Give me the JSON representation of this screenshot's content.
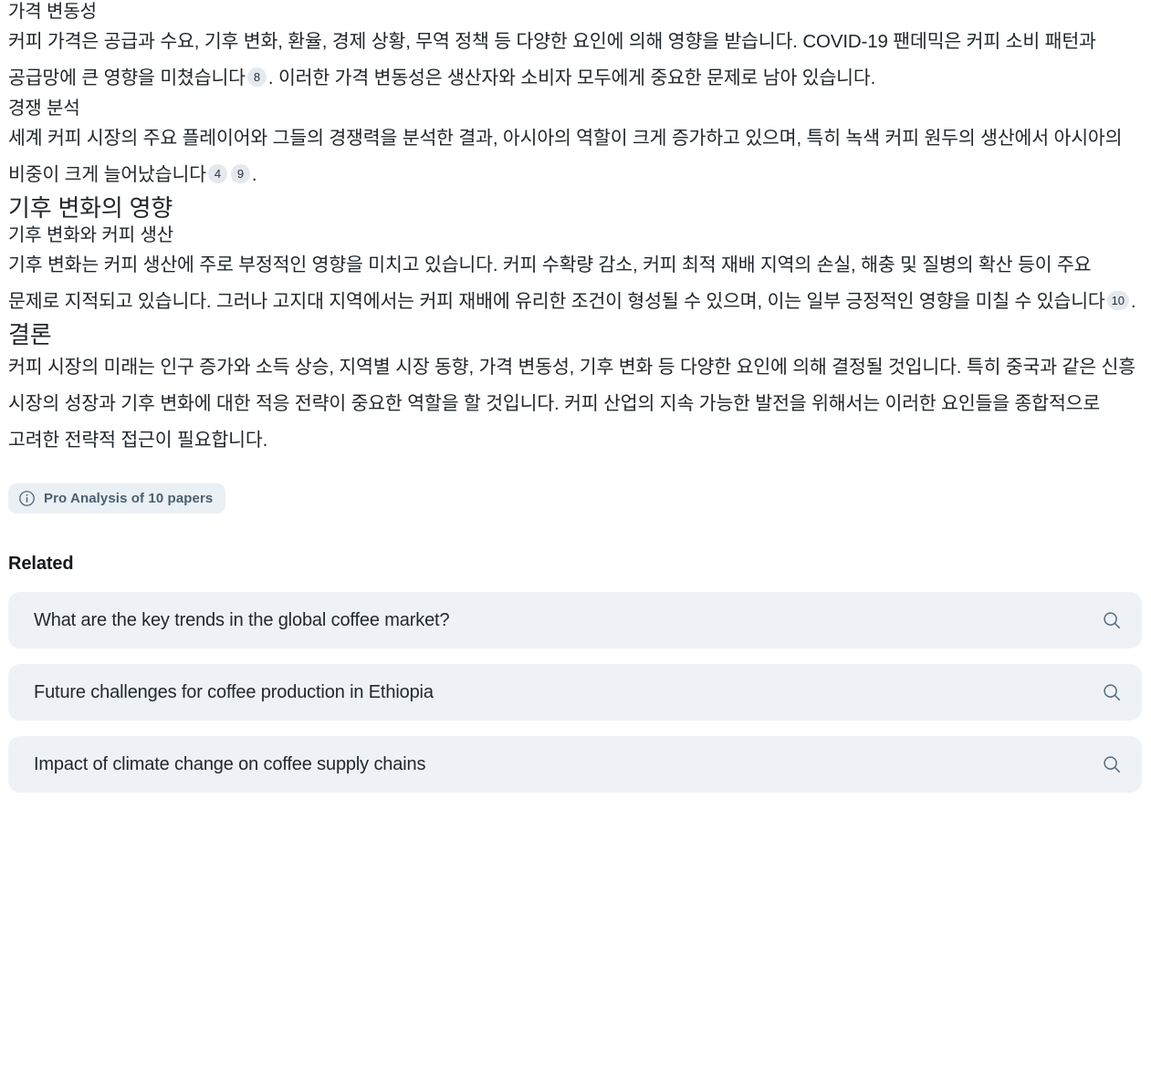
{
  "sections": {
    "price_volatility": {
      "heading": "가격 변동성",
      "paragraph_part1": "커피 가격은 공급과 수요, 기후 변화, 환율, 경제 상황, 무역 정책 등 다양한 요인에 의해 영향을 받습니다. COVID-19 팬데믹은 커피 소비 패턴과 공급망에 큰 영향을 미쳤습니다",
      "citation1": "8",
      "paragraph_part2": ". 이러한 가격 변동성은 생산자와 소비자 모두에게 중요한 문제로 남아 있습니다."
    },
    "competitive_analysis": {
      "heading": "경쟁 분석",
      "paragraph_part1": "세계 커피 시장의 주요 플레이어와 그들의 경쟁력을 분석한 결과, 아시아의 역할이 크게 증가하고 있으며, 특히 녹색 커피 원두의 생산에서 아시아의 비중이 크게 늘어났습니다",
      "citation1": "4",
      "citation2": "9",
      "paragraph_part2": "."
    },
    "climate_impact": {
      "heading": "기후 변화의 영향",
      "subheading": "기후 변화와 커피 생산",
      "paragraph_part1": "기후 변화는 커피 생산에 주로 부정적인 영향을 미치고 있습니다. 커피 수확량 감소, 커피 최적 재배 지역의 손실, 해충 및 질병의 확산 등이 주요 문제로 지적되고 있습니다. 그러나 고지대 지역에서는 커피 재배에 유리한 조건이 형성될 수 있으며, 이는 일부 긍정적인 영향을 미칠 수 있습니다",
      "citation1": "10",
      "paragraph_part2": "."
    },
    "conclusion": {
      "heading": "결론",
      "paragraph": "커피 시장의 미래는 인구 증가와 소득 상승, 지역별 시장 동향, 가격 변동성, 기후 변화 등 다양한 요인에 의해 결정될 것입니다. 특히 중국과 같은 신흥 시장의 성장과 기후 변화에 대한 적응 전략이 중요한 역할을 할 것입니다. 커피 산업의 지속 가능한 발전을 위해서는 이러한 요인들을 종합적으로 고려한 전략적 접근이 필요합니다."
    }
  },
  "pro_analysis": {
    "label": "Pro Analysis of 10 papers",
    "icon": "info-icon"
  },
  "related": {
    "title": "Related",
    "items": [
      {
        "question": "What are the key trends in the global coffee market?",
        "icon": "search-icon"
      },
      {
        "question": "Future challenges for coffee production in Ethiopia",
        "icon": "search-icon"
      },
      {
        "question": "Impact of climate change on coffee supply chains",
        "icon": "search-icon"
      }
    ]
  },
  "colors": {
    "background": "#ffffff",
    "text": "#22272b",
    "citation_bg": "#e3e9ee",
    "card_bg": "#eef2f6",
    "pro_pill_bg": "#eaf0f4",
    "pro_pill_text": "#4b5f6e",
    "icon": "#5a6f7d"
  }
}
